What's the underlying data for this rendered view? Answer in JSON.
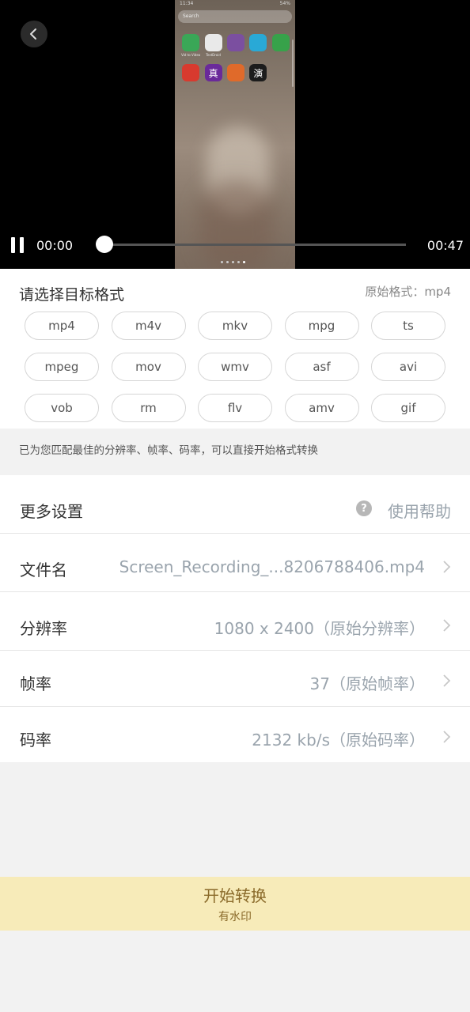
{
  "player": {
    "current_time": "00:00",
    "total_time": "00:47",
    "progress": 0.0,
    "phone_preview": {
      "status_time": "11:34",
      "status_right": "54%",
      "search_placeholder": "Search",
      "apps_row1": [
        {
          "label": "Vid to Video",
          "color": "#3aa757"
        },
        {
          "label": "TestDroid",
          "color": "#e9e9e9"
        },
        {
          "label": "",
          "color": "#7b4fa0"
        },
        {
          "label": "",
          "color": "#29a9d6"
        },
        {
          "label": "",
          "color": "#37a24a"
        }
      ],
      "apps_row2": [
        {
          "label": "",
          "color": "#d83a2e"
        },
        {
          "label": "真",
          "color": "#6a2a9a"
        },
        {
          "label": "",
          "color": "#e06a2a"
        },
        {
          "label": "演",
          "color": "#1c1c1c"
        }
      ]
    }
  },
  "format_panel": {
    "title": "请选择目标格式",
    "original_format": "原始格式：mp4",
    "formats": [
      "mp4",
      "m4v",
      "mkv",
      "mpg",
      "ts",
      "mpeg",
      "mov",
      "wmv",
      "asf",
      "avi",
      "vob",
      "rm",
      "flv",
      "amv",
      "gif"
    ]
  },
  "hint": "已为您匹配最佳的分辨率、帧率、码率，可以直接开始格式转换",
  "settings": {
    "more_settings": "更多设置",
    "help": "使用帮助",
    "filename_label": "文件名",
    "filename_value": "Screen_Recording_...8206788406.mp4",
    "resolution_label": "分辨率",
    "resolution_value": "1080 x 2400（原始分辨率）",
    "framerate_label": "帧率",
    "framerate_value": "37（原始帧率）",
    "bitrate_label": "码率",
    "bitrate_value": "2132 kb/s（原始码率）"
  },
  "start_button": {
    "label": "开始转换",
    "sublabel": "有水印"
  }
}
